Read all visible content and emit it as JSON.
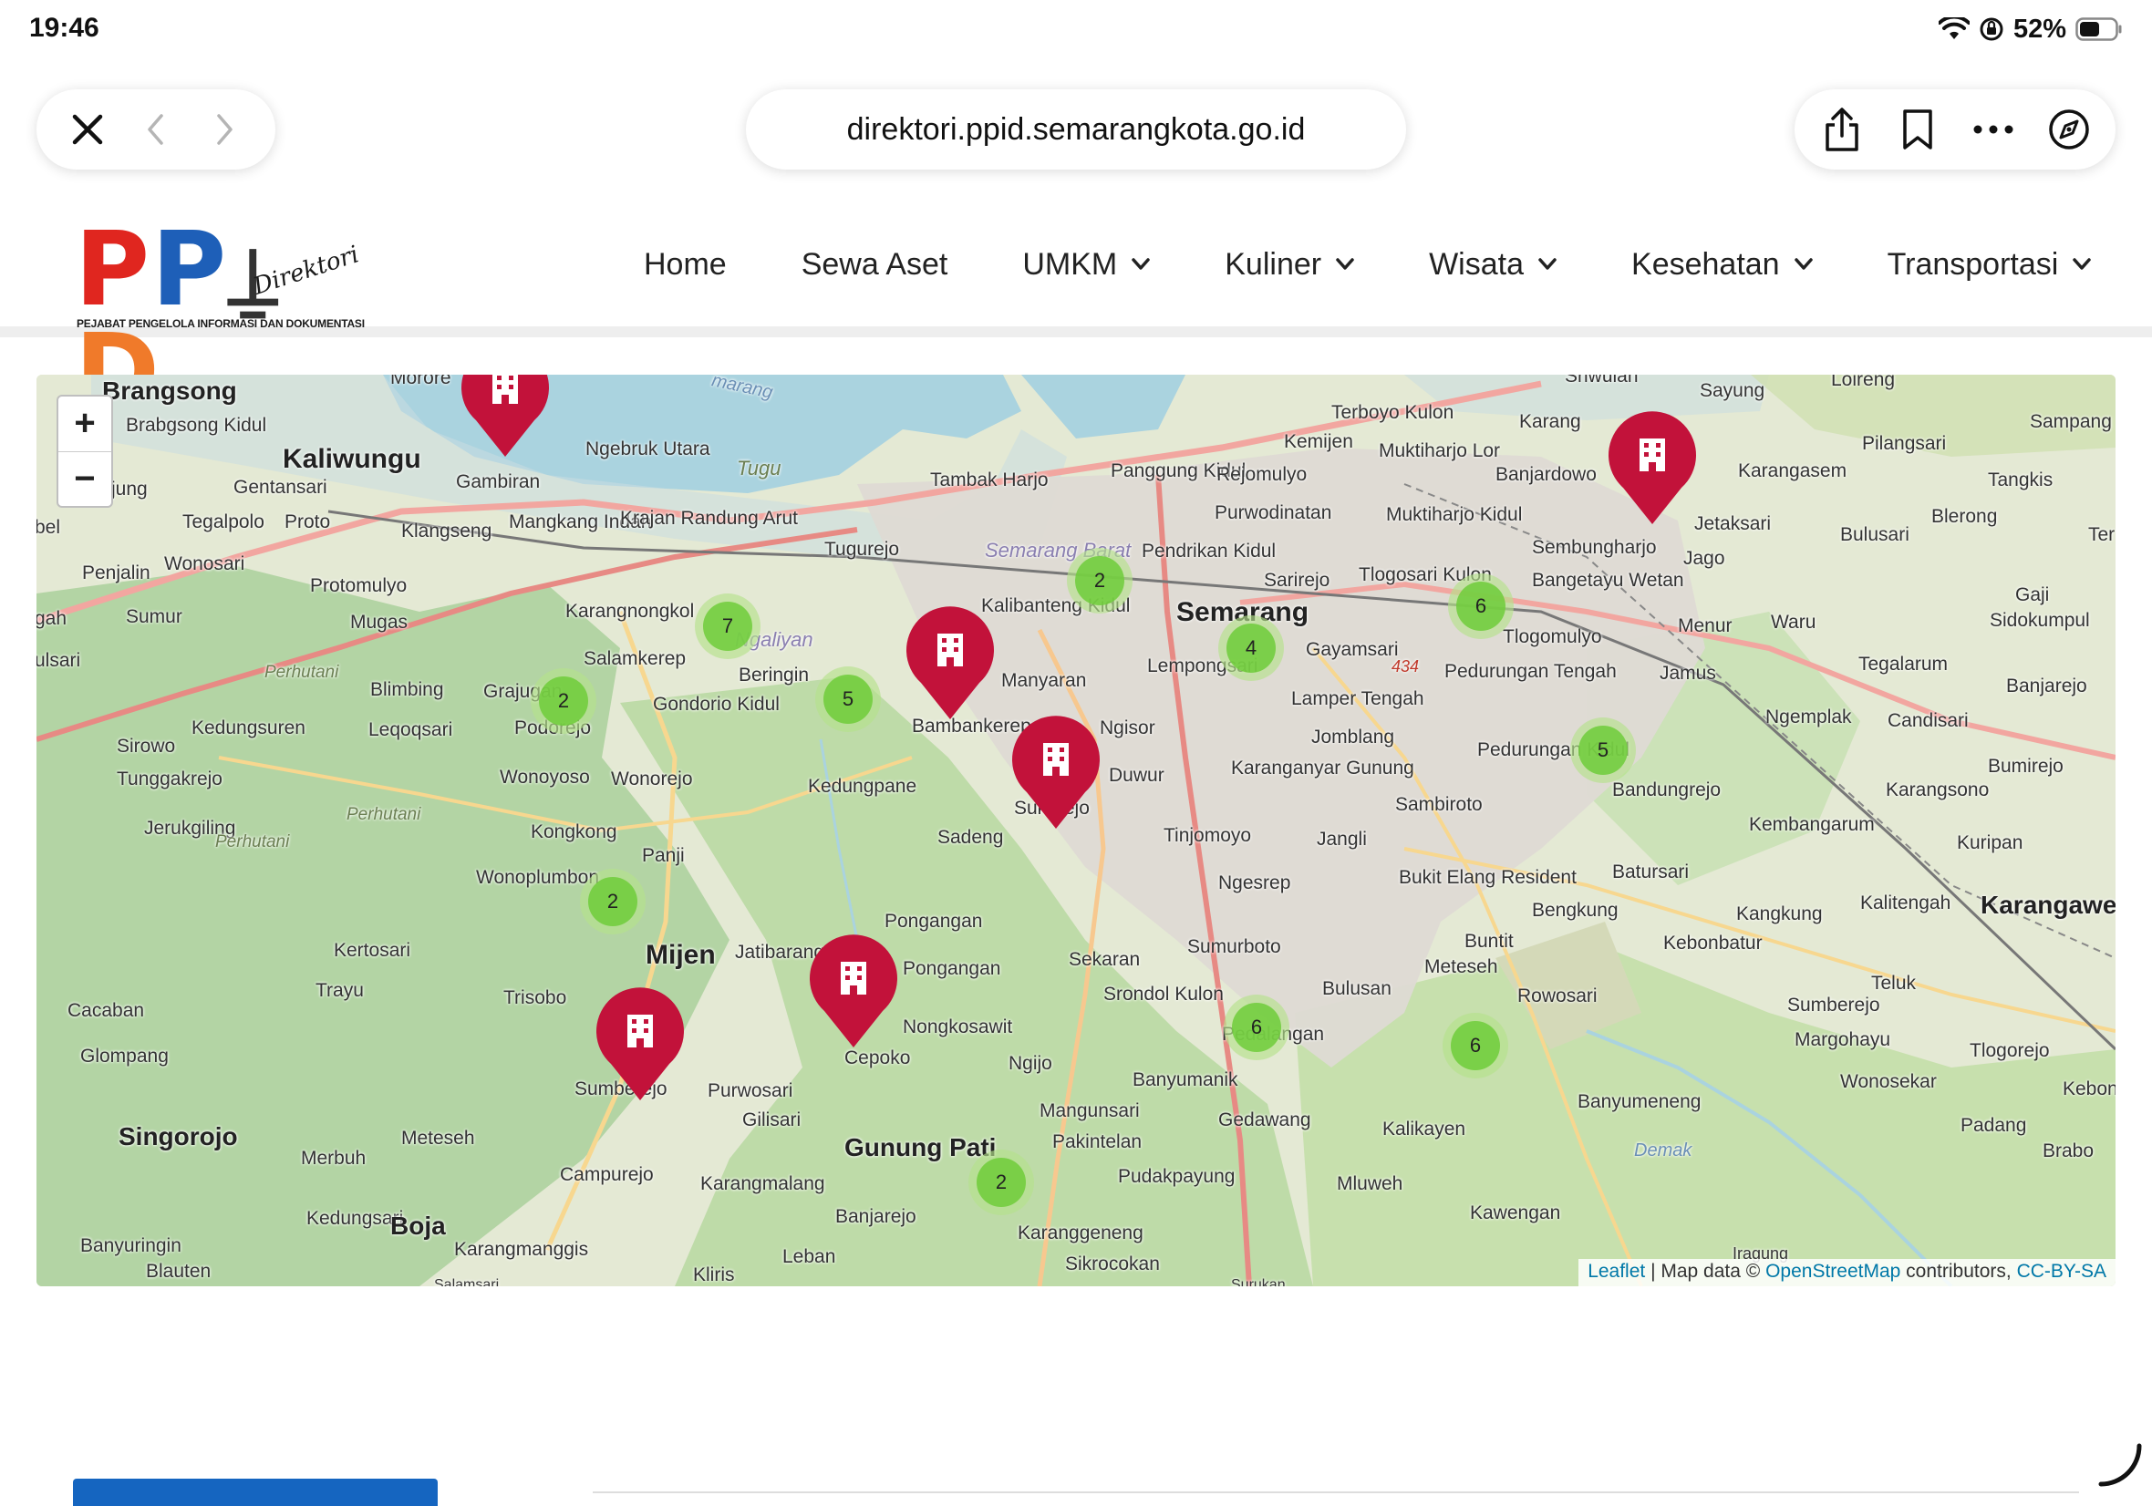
{
  "status_bar": {
    "time": "19:46",
    "battery": "52%"
  },
  "browser": {
    "url": "direktori.ppid.semarangkota.go.id",
    "icons": [
      "close-icon",
      "back-icon",
      "forward-icon",
      "share-icon",
      "bookmark-icon",
      "more-icon",
      "compass-icon"
    ]
  },
  "logo": {
    "letters": "PPID",
    "script": "Direktori",
    "tagline": "PEJABAT PENGELOLA INFORMASI DAN DOKUMENTASI",
    "colors": {
      "p1": "#e0261f",
      "p2": "#1e5fb8",
      "d": "#f07a2a"
    }
  },
  "nav": {
    "home": "Home",
    "sewa_aset": "Sewa Aset",
    "umkm": "UMKM",
    "kuliner": "Kuliner",
    "wisata": "Wisata",
    "kesehatan": "Kesehatan",
    "transportasi": "Transportasi"
  },
  "map": {
    "zoom_in": "+",
    "zoom_out": "−",
    "places": {
      "brangsong": "Brangsong",
      "brabgsong_kidul": "Brabgsong Kidul",
      "kaliwungu": "Kaliwungu",
      "gentansari": "Gentansari",
      "tegalpolo": "Tegalpolo",
      "proto": "Proto",
      "penjalin": "Penjalin",
      "wonosari_w": "Wonosari",
      "protomulyo": "Protomulyo",
      "sumur": "Sumur",
      "mugas": "Mugas",
      "perhutani1": "Perhutani",
      "blimbing": "Blimbing",
      "kedungsuren": "Kedungsuren",
      "legoqsari": "Leqoqsari",
      "sirowo": "Sirowo",
      "tunggakrejo": "Tunggakrejo",
      "jerukgiling": "Jerukgiling",
      "perhutani2": "Perhutani",
      "perhutani3": "Perhutani",
      "kertosari": "Kertosari",
      "trayu": "Trayu",
      "cacaban": "Cacaban",
      "glompang": "Glompang",
      "singorojo": "Singorojo",
      "merbuh": "Merbuh",
      "kedungsari": "Kedungsari",
      "boja": "Boja",
      "banyuringin": "Banyuringin",
      "blauten": "Blauten",
      "gambiran": "Gambiran",
      "ngebruk_utara": "Ngebruk Utara",
      "tugu": "Tugu",
      "klangseng": "Klangseng",
      "mangkang_indah": "Mangkang Indah",
      "krajan_randung_arut": "Krajan Randung Arut",
      "tugurejo": "Tugurejo",
      "karangnongkol": "Karangnongkol",
      "salamkerep": "Salamkerep",
      "grajugan": "Grajugan",
      "podorejo": "Podorejo",
      "beringin": "Beringin",
      "gondorio_kidul": "Gondorio Kidul",
      "wonoyoso": "Wonoyoso",
      "wonorejo": "Wonorejo",
      "kongkong": "Kongkong",
      "panji": "Panji",
      "wonoplumbon": "Wonoplumbon",
      "mijen": "Mijen",
      "jatibarang": "Jatibarang",
      "trisobo": "Trisobo",
      "sumberejo": "Sumberejo",
      "purwosari": "Purwosari",
      "gilisari": "Gilisari",
      "meteseh_w": "Meteseh",
      "campurejo": "Campurejo",
      "karangmalang": "Karangmalang",
      "banjarejo": "Banjarejo",
      "karangmanggis": "Karangmanggis",
      "leban": "Leban",
      "kliris": "Kliris",
      "tambak_harjo": "Tambak Harjo",
      "semarang_barat": "Semarang Barat",
      "ngaliyan": "Ngaliyan",
      "bambankerep": "Bambankerep",
      "kalibanteng_kidul": "Kalibanteng Kidul",
      "manyaran": "Manyaran",
      "kedungpane": "Kedungpane",
      "sadeng": "Sadeng",
      "sukorejo": "Sukorejo",
      "pongangan": "Pongangan",
      "pongangan2": "Pongangan",
      "nongkosawit": "Nongkosawit",
      "cepoko": "Cepoko",
      "ngijo": "Ngijo",
      "mangunsari": "Mangunsari",
      "gunung_pati": "Gunung Pati",
      "pakintelan": "Pakintelan",
      "pudakpayung": "Pudakpayung",
      "karanggeneng": "Karanggeneng",
      "sikrocokan": "Sikrocokan",
      "panggung_kidul": "Panggung Kidul",
      "pendrikan_kidul": "Pendrikan Kidul",
      "semarang": "Semarang",
      "lempongsari": "Lempongsari",
      "ngisor": "Ngisor",
      "duwur": "Duwur",
      "tinjomoyo": "Tinjomoyo",
      "sekaran": "Sekaran",
      "srondol_kulon": "Srondol Kulon",
      "sumurboto": "Sumurboto",
      "ngesrep": "Ngesrep",
      "banyumanik": "Banyumanik",
      "gedawang": "Gedawang",
      "pedalangan": "Pedalangan",
      "bulusan": "Bulusan",
      "jangli": "Jangli",
      "jomblang": "Jomblang",
      "karanganyar_gunung": "Karanganyar Gunung",
      "lamper_tengah": "Lamper Tengah",
      "gayamsari": "Gayamsari",
      "sarirejo": "Sarirejo",
      "purwodinatan": "Purwodinatan",
      "rejomulyo": "Rejomulyo",
      "kemijen": "Kemijen",
      "terboyo_kulon": "Terboyo Kulon",
      "muktiharjo_lor": "Muktiharjo Lor",
      "muktiharjo_kidul": "Muktiharjo Kidul",
      "tlogosari_kulon": "Tlogosari Kulon",
      "pedurungan_tengah": "Pedurungan Tengah",
      "tlogomulyo": "Tlogomulyo",
      "sambiroto": "Sambiroto",
      "pedurungan_kidul": "Pedurungan Kidul",
      "bukit_elang": "Bukit Elang Resident",
      "bengkung": "Bengkung",
      "buntit": "Buntit",
      "meteseh_e": "Meteseh",
      "rowosari": "Rowosari",
      "kalikayen": "Kalikayen",
      "mluweh": "Mluweh",
      "kawengan": "Kawengan",
      "banyumeneng": "Banyumeneng",
      "demak": "Demak",
      "bandungrejo": "Bandungrejo",
      "batursari": "Batursari",
      "kebonbatur": "Kebonbatur",
      "kangkung": "Kangkung",
      "sumberejo_e": "Sumberejo",
      "margohayu": "Margohayu",
      "wonosekar": "Wonosekar",
      "tlogorejo": "Tlogorejo",
      "padang": "Padang",
      "brabo": "Brabo",
      "teluk": "Teluk",
      "kalitengah": "Kalitengah",
      "karangawen": "Karangawen",
      "kuripan": "Kuripan",
      "kembangarum": "Kembangarum",
      "karangsono": "Karangsono",
      "bumirejo": "Bumirejo",
      "ngemplak": "Ngemplak",
      "candisari": "Candisari",
      "tegalarum": "Tegalarum",
      "banjarejo_e": "Banjarejo",
      "waru": "Waru",
      "menur": "Menur",
      "jamus": "Jamus",
      "gaji": "Gaji",
      "sidokumpul": "Sidokumpul",
      "blerong": "Blerong",
      "bulusari": "Bulusari",
      "jago": "Jago",
      "jetaksari": "Jetaksari",
      "sembungharjo": "Sembungharjo",
      "bangetayu_wetan": "Bangetayu Wetan",
      "banjardowo": "Banjardowo",
      "karangasem": "Karangasem",
      "tangkis": "Tangkis",
      "sampang": "Sampang",
      "pilangsari": "Pilangsari",
      "loireng": "Loireng",
      "sayung": "Sayung",
      "karangroto": "Karang",
      "sriwulan": "Sriwulan",
      "mororejo": "Morore",
      "jung": "jung",
      "bel": "bel",
      "gah": "gah",
      "ulsari": "ulsari",
      "ter": "Ter",
      "kebona": "Kebona",
      "hiang": "Iragung",
      "sukun": "Surukan",
      "salamsari": "Salamsari",
      "highway_434": "434",
      "marang": "marang"
    },
    "clusters": [
      "7",
      "2",
      "5",
      "2",
      "4",
      "6",
      "5",
      "2",
      "6",
      "6",
      "2",
      "2"
    ],
    "attribution": {
      "leaflet": "Leaflet",
      "map_data": " | Map data © ",
      "osm": "OpenStreetMap",
      "contributors": " contributors, ",
      "license": "CC-BY-SA"
    }
  }
}
